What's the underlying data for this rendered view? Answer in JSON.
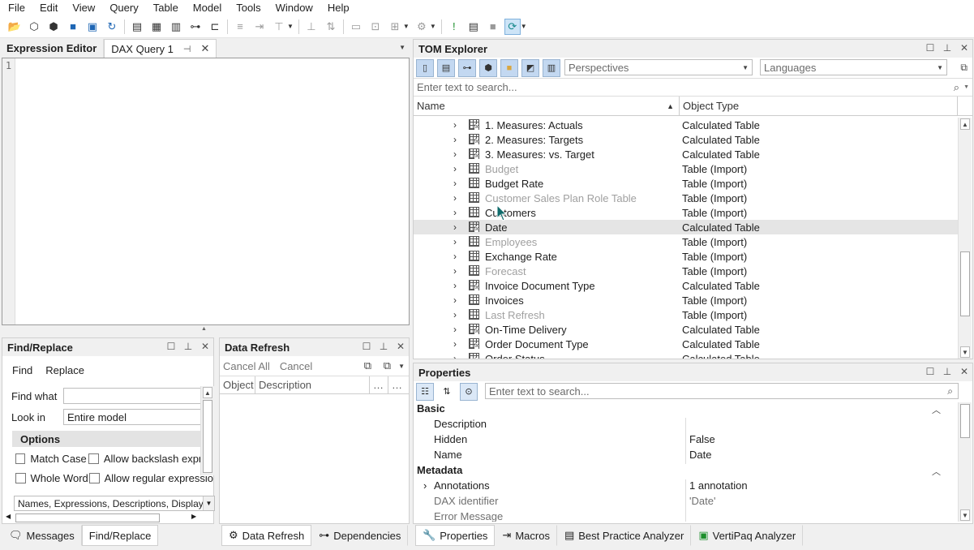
{
  "menu": [
    "File",
    "Edit",
    "View",
    "Query",
    "Table",
    "Model",
    "Tools",
    "Window",
    "Help"
  ],
  "editor": {
    "tabs": [
      "Expression Editor",
      "DAX Query 1"
    ],
    "line_number": "1"
  },
  "find_replace": {
    "title": "Find/Replace",
    "tabs": [
      "Find",
      "Replace"
    ],
    "find_what_label": "Find what",
    "find_what_value": "",
    "look_in_label": "Look in",
    "look_in_value": "Entire model",
    "options_label": "Options",
    "match_case": "Match Case",
    "allow_backslash": "Allow backslash expres",
    "whole_word": "Whole Word",
    "allow_regex": "Allow regular expressio",
    "search_scope": "Names, Expressions, Descriptions, Display F"
  },
  "data_refresh": {
    "title": "Data Refresh",
    "cancel_all": "Cancel All",
    "cancel": "Cancel",
    "col_object": "Object",
    "col_description": "Description"
  },
  "left_bottom_tabs": [
    "Messages",
    "Find/Replace"
  ],
  "mid_bottom_tabs": [
    "Data Refresh",
    "Dependencies"
  ],
  "tom": {
    "title": "TOM Explorer",
    "perspectives": "Perspectives",
    "languages": "Languages",
    "search_placeholder": "Enter text to search...",
    "col_name": "Name",
    "col_type": "Object Type",
    "rows": [
      {
        "name": "1. Measures: Actuals",
        "type": "Calculated Table",
        "icon": "calculated-table-icon",
        "hidden": false
      },
      {
        "name": "2. Measures: Targets",
        "type": "Calculated Table",
        "icon": "calculated-table-icon",
        "hidden": false
      },
      {
        "name": "3. Measures: vs. Target",
        "type": "Calculated Table",
        "icon": "calculated-table-icon",
        "hidden": false
      },
      {
        "name": "Budget",
        "type": "Table (Import)",
        "icon": "table-icon",
        "hidden": true
      },
      {
        "name": "Budget Rate",
        "type": "Table (Import)",
        "icon": "table-icon",
        "hidden": false
      },
      {
        "name": "Customer Sales Plan Role Table",
        "type": "Table (Import)",
        "icon": "table-icon",
        "hidden": true
      },
      {
        "name": "Customers",
        "type": "Table (Import)",
        "icon": "table-icon",
        "hidden": false
      },
      {
        "name": "Date",
        "type": "Calculated Table",
        "icon": "calculated-table-icon",
        "hidden": false,
        "selected": true
      },
      {
        "name": "Employees",
        "type": "Table (Import)",
        "icon": "table-icon",
        "hidden": true
      },
      {
        "name": "Exchange Rate",
        "type": "Table (Import)",
        "icon": "table-icon",
        "hidden": false
      },
      {
        "name": "Forecast",
        "type": "Table (Import)",
        "icon": "table-icon",
        "hidden": true
      },
      {
        "name": "Invoice Document Type",
        "type": "Calculated Table",
        "icon": "calculated-table-icon",
        "hidden": false
      },
      {
        "name": "Invoices",
        "type": "Table (Import)",
        "icon": "table-icon",
        "hidden": false
      },
      {
        "name": "Last Refresh",
        "type": "Table (Import)",
        "icon": "table-icon",
        "hidden": true
      },
      {
        "name": "On-Time Delivery",
        "type": "Calculated Table",
        "icon": "calculated-table-icon",
        "hidden": false
      },
      {
        "name": "Order Document Type",
        "type": "Calculated Table",
        "icon": "calculated-table-icon",
        "hidden": false
      },
      {
        "name": "Order Status",
        "type": "Calculated Table",
        "icon": "calculated-table-icon",
        "hidden": false
      }
    ]
  },
  "properties": {
    "title": "Properties",
    "search_placeholder": "Enter text to search...",
    "rows": [
      {
        "kind": "category",
        "key": "Basic"
      },
      {
        "kind": "prop",
        "key": "Description",
        "value": ""
      },
      {
        "kind": "prop",
        "key": "Hidden",
        "value": "False"
      },
      {
        "kind": "prop",
        "key": "Name",
        "value": "Date"
      },
      {
        "kind": "category",
        "key": "Metadata"
      },
      {
        "kind": "prop",
        "key": "Annotations",
        "value": "1 annotation",
        "expandable": true
      },
      {
        "kind": "prop",
        "key": "DAX identifier",
        "value": "'Date'",
        "dim": true
      },
      {
        "kind": "prop",
        "key": "Error Message",
        "value": "",
        "dim": true
      }
    ]
  },
  "right_bottom_tabs": [
    "Properties",
    "Macros",
    "Best Practice Analyzer",
    "VertiPaq Analyzer"
  ]
}
